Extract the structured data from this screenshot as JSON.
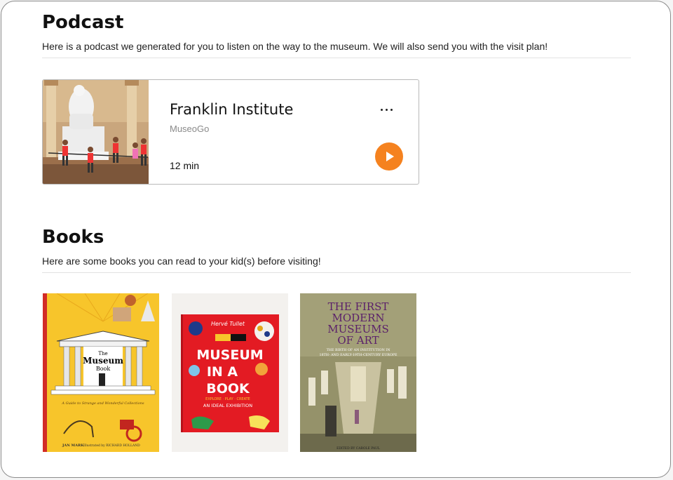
{
  "podcast_section": {
    "title": "Podcast",
    "description": "Here is a podcast we generated for you to listen on the way to the museum. We will also send you with the visit plan!",
    "episode": {
      "title": "Franklin Institute",
      "source": "MuseoGo",
      "duration": "12 min",
      "more_icon": "ellipsis-icon",
      "play_icon": "play-icon"
    }
  },
  "books_section": {
    "title": "Books",
    "description": "Here are some books you can read to your kid(s) before visiting!",
    "books": [
      {
        "cover_title_small": "The",
        "cover_title": "Museum",
        "cover_title_2": "Book",
        "cover_subtitle": "A Guide to Strange and Wonderful Collections",
        "author_line": "JAN MARK",
        "illustrator_line": "Illustrated by RICHARD HOLLAND"
      },
      {
        "cover_author": "Hervé Tullet",
        "cover_title_1": "MUSEUM",
        "cover_title_2": "IN A",
        "cover_title_3": "BOOK",
        "cover_tagline": "EXPLORE · PLAY · CREATE",
        "cover_subtitle": "AN IDEAL EXHIBITION"
      },
      {
        "cover_title_1": "THE FIRST",
        "cover_title_2": "MODERN",
        "cover_title_3": "MUSEUMS",
        "cover_title_4": "OF ART",
        "cover_subtitle_1": "THE BIRTH OF AN INSTITUTION IN",
        "cover_subtitle_2": "18TH- AND EARLY-19TH-CENTURY EUROPE",
        "editor_line": "EDITED BY CAROLE PAUL"
      }
    ]
  },
  "colors": {
    "accent": "#f5821f",
    "frame_border": "#8c8c8c",
    "divider": "#e2e2e2"
  }
}
